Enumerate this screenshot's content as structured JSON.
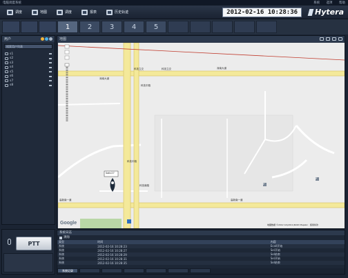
{
  "window": {
    "title": "电脑调度系统",
    "menu": [
      "系统",
      "选项",
      "帮助"
    ]
  },
  "toolbar": {
    "buttons": [
      {
        "label": "调度",
        "icon": "dispatch-icon"
      },
      {
        "label": "地图",
        "icon": "map-icon"
      },
      {
        "label": "调度",
        "icon": "dispatch-icon"
      },
      {
        "label": "报表",
        "icon": "report-icon"
      },
      {
        "label": "历史轨迹",
        "icon": "history-track-icon"
      }
    ],
    "datetime": "2012-02-16 10:28:36",
    "brand": "Hytera"
  },
  "view_tabs": [
    "1",
    "2",
    "3",
    "4",
    "5"
  ],
  "active_view_tab": "1",
  "left_panel": {
    "header": "用户",
    "search_placeholder": "搜索用户列表",
    "users": [
      "s1",
      "s2",
      "s3",
      "s4",
      "s5",
      "s6",
      "s7",
      "s8"
    ]
  },
  "map": {
    "header": "地图",
    "roads": [
      "科技立交",
      "科技立交",
      "深南大道",
      "深南大道",
      "科技中路",
      "高新南一道",
      "高新南一道",
      "科技中路",
      "科技南路"
    ],
    "marker_label": "Sallc27",
    "provider": "Google",
    "copyright": "地图数据 ©2012 GS(2011)6020 Mapabc · 使用条款",
    "poi_labels": [
      "P",
      "P"
    ]
  },
  "ptt": {
    "label": "PTT"
  },
  "log_panel": {
    "header": "系统日志",
    "toolbar_label": "清除",
    "columns": [
      "类型",
      "时间",
      "内容"
    ],
    "rows": [
      [
        "系统",
        "2012-02-16 10:28:23",
        "Ecall开始"
      ],
      [
        "系统",
        "2012-02-16 10:28:27",
        "Sel开始"
      ],
      [
        "系统",
        "2012-02-16 10:28:29",
        "Sel结束"
      ],
      [
        "系统",
        "2012-02-16 10:28:31",
        "Sel开始"
      ],
      [
        "系统",
        "2012-02-16 10:28:35",
        "Sel结束"
      ]
    ],
    "tabs": [
      "系统记录",
      "",
      "",
      "",
      "",
      "",
      ""
    ]
  },
  "colors": {
    "road_yellow": "#f4e99a",
    "road_border": "#d9c46a",
    "accent_red": "#c0392b",
    "marker": "#1c2a3a"
  }
}
